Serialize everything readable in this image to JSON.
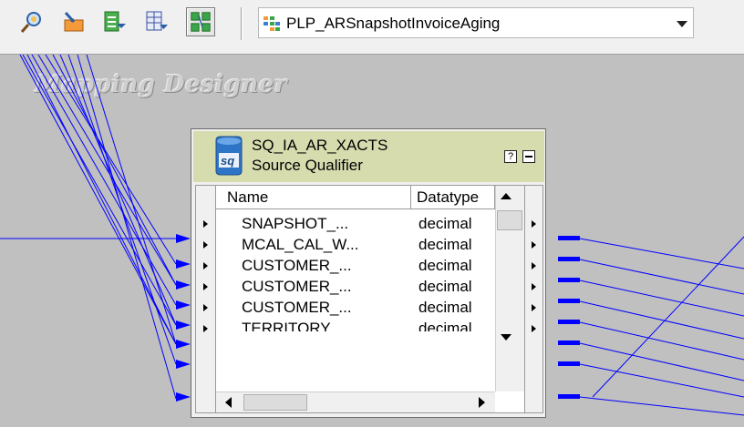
{
  "toolbar": {
    "buttons": [
      {
        "icon": "source-analyzer-icon"
      },
      {
        "icon": "target-designer-icon"
      },
      {
        "icon": "transformation-developer-icon"
      },
      {
        "icon": "mapplet-designer-icon"
      },
      {
        "icon": "mapping-designer-icon",
        "pressed": true
      }
    ],
    "mapping_selector": {
      "icon": "mapping-icon",
      "value": "PLP_ARSnapshotInvoiceAging"
    }
  },
  "canvas": {
    "watermark": "Mapping Designer",
    "link_color": "#0000ff"
  },
  "transformation": {
    "name": "SQ_IA_AR_XACTS",
    "type": "Source Qualifier",
    "icon": "source-qualifier-icon",
    "help_label": "?",
    "header_color": "#d6dcae",
    "columns": {
      "name": "Name",
      "datatype": "Datatype"
    },
    "ports": [
      {
        "name": "SNAPSHOT_...",
        "datatype": "decimal"
      },
      {
        "name": "MCAL_CAL_W...",
        "datatype": "decimal"
      },
      {
        "name": "CUSTOMER_...",
        "datatype": "decimal"
      },
      {
        "name": "CUSTOMER_...",
        "datatype": "decimal"
      },
      {
        "name": "CUSTOMER_...",
        "datatype": "decimal"
      },
      {
        "name": "TERRITORY_...",
        "datatype": "decimal"
      }
    ]
  }
}
